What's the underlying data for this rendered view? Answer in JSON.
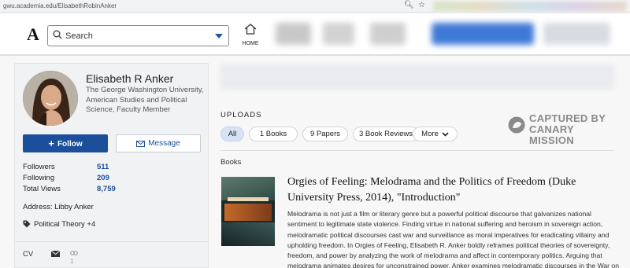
{
  "browser": {
    "url": "gwu.academia.edu/ElisabethRobinAnker"
  },
  "header": {
    "logo": "A",
    "search_placeholder": "Search",
    "home_label": "HOME"
  },
  "profile": {
    "name": "Elisabeth R Anker",
    "affiliation": "The George Washington University, American Studies and Political Science, Faculty Member",
    "follow_label": "Follow",
    "message_label": "Message",
    "stats": [
      {
        "label": "Followers",
        "value": "511"
      },
      {
        "label": "Following",
        "value": "209"
      },
      {
        "label": "Total Views",
        "value": "8,759"
      }
    ],
    "address": "Address: Libby Anker",
    "tag": "Political Theory +4",
    "footer": {
      "cv": "CV",
      "link_count": "1"
    }
  },
  "uploads": {
    "title": "UPLOADS",
    "pills": [
      {
        "label": "All",
        "active": true
      },
      {
        "label": "1 Books"
      },
      {
        "label": "9 Papers"
      },
      {
        "label": "3 Book Reviews"
      },
      {
        "label": "More"
      }
    ],
    "stamp_line1": "CAPTURED BY",
    "stamp_line2": "CANARY MISSION",
    "section_label": "Books",
    "book": {
      "title": "Orgies of Feeling: Melodrama and the Politics of Freedom (Duke University Press, 2014), \"Introduction\"",
      "description": "Melodrama is not just a film or literary genre but a powerful political discourse that galvanizes national sentiment to legitimate state violence. Finding virtue in national suffering and heroism in sovereign action, melodramatic political discourses cast war and surveillance as moral imperatives for eradicating villainy and upholding freedom. In Orgies of Feeling, Elisabeth R. Anker boldly reframes political theories of sovereignty, freedom, and power by analyzing the work of melodrama and affect in contemporary politics. Arguing that melodrama animates desires for unconstrained power, Anker examines melodramatic discourses in the War on Terror, neoliberal politics, anticommunist rhetoric,"
    }
  },
  "colors": {
    "brand_blue": "#1b4f9c",
    "active_pill": "#d7e3f5"
  }
}
